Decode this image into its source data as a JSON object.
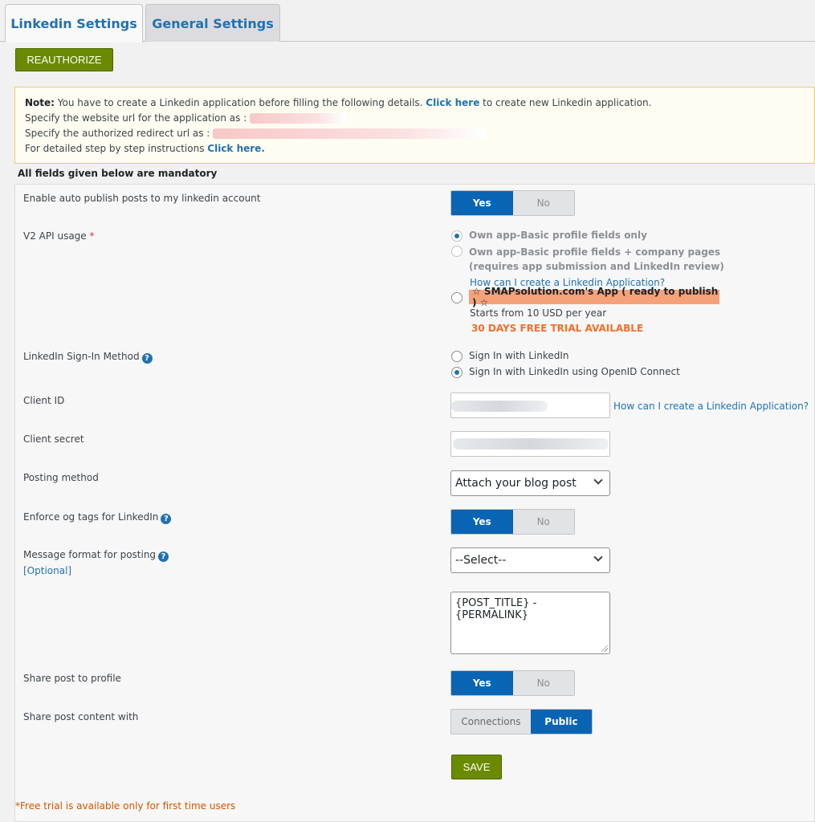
{
  "tabs": [
    {
      "label": "Linkedin Settings",
      "active": true
    },
    {
      "label": "General Settings",
      "active": false
    }
  ],
  "reauthorize_label": "REAUTHORIZE",
  "note": {
    "prefix": "Note:",
    "text1": " You have to create a Linkedin application before filling the following details. ",
    "click_here": "Click here",
    "text2": " to create new Linkedin application.",
    "website_url": "Specify the website url for the application as : ",
    "redirect_url": "Specify the authorized redirect url as : ",
    "instructions": "For detailed step by step instructions ",
    "click_here2": "Click here."
  },
  "mandatory_text": "All fields given below are mandatory",
  "fields": {
    "auto_publish": {
      "label": "Enable auto publish posts to my linkedin account",
      "yes": "Yes",
      "no": "No",
      "value": "Yes"
    },
    "api_usage": {
      "label": "V2 API usage",
      "required_mark": "*",
      "option1": "Own app-Basic profile fields only",
      "option2_line1": "Own app-Basic profile fields + company pages",
      "option2_line2": "(requires app submission and LinkedIn review)",
      "help_link": "How can I create a Linkedin Application?",
      "option3": "☆  SMAPsolution.com's App ( ready to publish ) ☆",
      "price": "Starts from 10 USD per year",
      "trial": "30 DAYS FREE TRIAL AVAILABLE",
      "selected": "option1"
    },
    "signin": {
      "label": "LinkedIn Sign-In Method",
      "option1": "Sign In with LinkedIn",
      "option2": "Sign In with LinkedIn using OpenID Connect",
      "selected": "option2"
    },
    "client_id": {
      "label": "Client ID",
      "help_link": "How can I create a Linkedin Application?"
    },
    "client_secret": {
      "label": "Client secret"
    },
    "posting_method": {
      "label": "Posting method",
      "value": "Attach your blog post"
    },
    "og_tags": {
      "label": "Enforce og tags for LinkedIn",
      "yes": "Yes",
      "no": "No",
      "value": "Yes"
    },
    "message_format": {
      "label": "Message format for posting",
      "optional": "[Optional]",
      "select_value": "--Select--",
      "textarea_value": "{POST_TITLE} - {PERMALINK}"
    },
    "share_profile": {
      "label": "Share post to profile",
      "yes": "Yes",
      "no": "No",
      "value": "Yes"
    },
    "share_content": {
      "label": "Share post content with",
      "connections": "Connections",
      "public": "Public",
      "value": "Public"
    }
  },
  "save_label": "SAVE",
  "footnote": "*Free trial is available only for first time users",
  "colors": {
    "accent": "#0a64b4",
    "button_green": "#6a8a00",
    "trial_orange": "#f56e28",
    "smap_highlight": "#f5a27a"
  }
}
